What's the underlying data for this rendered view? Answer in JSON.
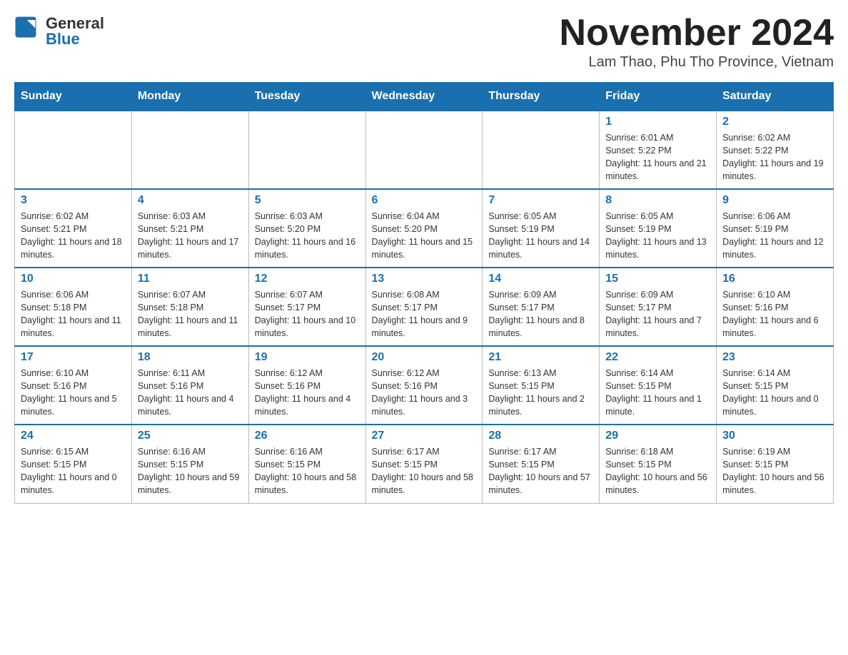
{
  "header": {
    "logo_general": "General",
    "logo_blue": "Blue",
    "month_title": "November 2024",
    "location": "Lam Thao, Phu Tho Province, Vietnam"
  },
  "weekdays": [
    "Sunday",
    "Monday",
    "Tuesday",
    "Wednesday",
    "Thursday",
    "Friday",
    "Saturday"
  ],
  "weeks": [
    [
      {
        "day": "",
        "info": ""
      },
      {
        "day": "",
        "info": ""
      },
      {
        "day": "",
        "info": ""
      },
      {
        "day": "",
        "info": ""
      },
      {
        "day": "",
        "info": ""
      },
      {
        "day": "1",
        "info": "Sunrise: 6:01 AM\nSunset: 5:22 PM\nDaylight: 11 hours and 21 minutes."
      },
      {
        "day": "2",
        "info": "Sunrise: 6:02 AM\nSunset: 5:22 PM\nDaylight: 11 hours and 19 minutes."
      }
    ],
    [
      {
        "day": "3",
        "info": "Sunrise: 6:02 AM\nSunset: 5:21 PM\nDaylight: 11 hours and 18 minutes."
      },
      {
        "day": "4",
        "info": "Sunrise: 6:03 AM\nSunset: 5:21 PM\nDaylight: 11 hours and 17 minutes."
      },
      {
        "day": "5",
        "info": "Sunrise: 6:03 AM\nSunset: 5:20 PM\nDaylight: 11 hours and 16 minutes."
      },
      {
        "day": "6",
        "info": "Sunrise: 6:04 AM\nSunset: 5:20 PM\nDaylight: 11 hours and 15 minutes."
      },
      {
        "day": "7",
        "info": "Sunrise: 6:05 AM\nSunset: 5:19 PM\nDaylight: 11 hours and 14 minutes."
      },
      {
        "day": "8",
        "info": "Sunrise: 6:05 AM\nSunset: 5:19 PM\nDaylight: 11 hours and 13 minutes."
      },
      {
        "day": "9",
        "info": "Sunrise: 6:06 AM\nSunset: 5:19 PM\nDaylight: 11 hours and 12 minutes."
      }
    ],
    [
      {
        "day": "10",
        "info": "Sunrise: 6:06 AM\nSunset: 5:18 PM\nDaylight: 11 hours and 11 minutes."
      },
      {
        "day": "11",
        "info": "Sunrise: 6:07 AM\nSunset: 5:18 PM\nDaylight: 11 hours and 11 minutes."
      },
      {
        "day": "12",
        "info": "Sunrise: 6:07 AM\nSunset: 5:17 PM\nDaylight: 11 hours and 10 minutes."
      },
      {
        "day": "13",
        "info": "Sunrise: 6:08 AM\nSunset: 5:17 PM\nDaylight: 11 hours and 9 minutes."
      },
      {
        "day": "14",
        "info": "Sunrise: 6:09 AM\nSunset: 5:17 PM\nDaylight: 11 hours and 8 minutes."
      },
      {
        "day": "15",
        "info": "Sunrise: 6:09 AM\nSunset: 5:17 PM\nDaylight: 11 hours and 7 minutes."
      },
      {
        "day": "16",
        "info": "Sunrise: 6:10 AM\nSunset: 5:16 PM\nDaylight: 11 hours and 6 minutes."
      }
    ],
    [
      {
        "day": "17",
        "info": "Sunrise: 6:10 AM\nSunset: 5:16 PM\nDaylight: 11 hours and 5 minutes."
      },
      {
        "day": "18",
        "info": "Sunrise: 6:11 AM\nSunset: 5:16 PM\nDaylight: 11 hours and 4 minutes."
      },
      {
        "day": "19",
        "info": "Sunrise: 6:12 AM\nSunset: 5:16 PM\nDaylight: 11 hours and 4 minutes."
      },
      {
        "day": "20",
        "info": "Sunrise: 6:12 AM\nSunset: 5:16 PM\nDaylight: 11 hours and 3 minutes."
      },
      {
        "day": "21",
        "info": "Sunrise: 6:13 AM\nSunset: 5:15 PM\nDaylight: 11 hours and 2 minutes."
      },
      {
        "day": "22",
        "info": "Sunrise: 6:14 AM\nSunset: 5:15 PM\nDaylight: 11 hours and 1 minute."
      },
      {
        "day": "23",
        "info": "Sunrise: 6:14 AM\nSunset: 5:15 PM\nDaylight: 11 hours and 0 minutes."
      }
    ],
    [
      {
        "day": "24",
        "info": "Sunrise: 6:15 AM\nSunset: 5:15 PM\nDaylight: 11 hours and 0 minutes."
      },
      {
        "day": "25",
        "info": "Sunrise: 6:16 AM\nSunset: 5:15 PM\nDaylight: 10 hours and 59 minutes."
      },
      {
        "day": "26",
        "info": "Sunrise: 6:16 AM\nSunset: 5:15 PM\nDaylight: 10 hours and 58 minutes."
      },
      {
        "day": "27",
        "info": "Sunrise: 6:17 AM\nSunset: 5:15 PM\nDaylight: 10 hours and 58 minutes."
      },
      {
        "day": "28",
        "info": "Sunrise: 6:17 AM\nSunset: 5:15 PM\nDaylight: 10 hours and 57 minutes."
      },
      {
        "day": "29",
        "info": "Sunrise: 6:18 AM\nSunset: 5:15 PM\nDaylight: 10 hours and 56 minutes."
      },
      {
        "day": "30",
        "info": "Sunrise: 6:19 AM\nSunset: 5:15 PM\nDaylight: 10 hours and 56 minutes."
      }
    ]
  ]
}
